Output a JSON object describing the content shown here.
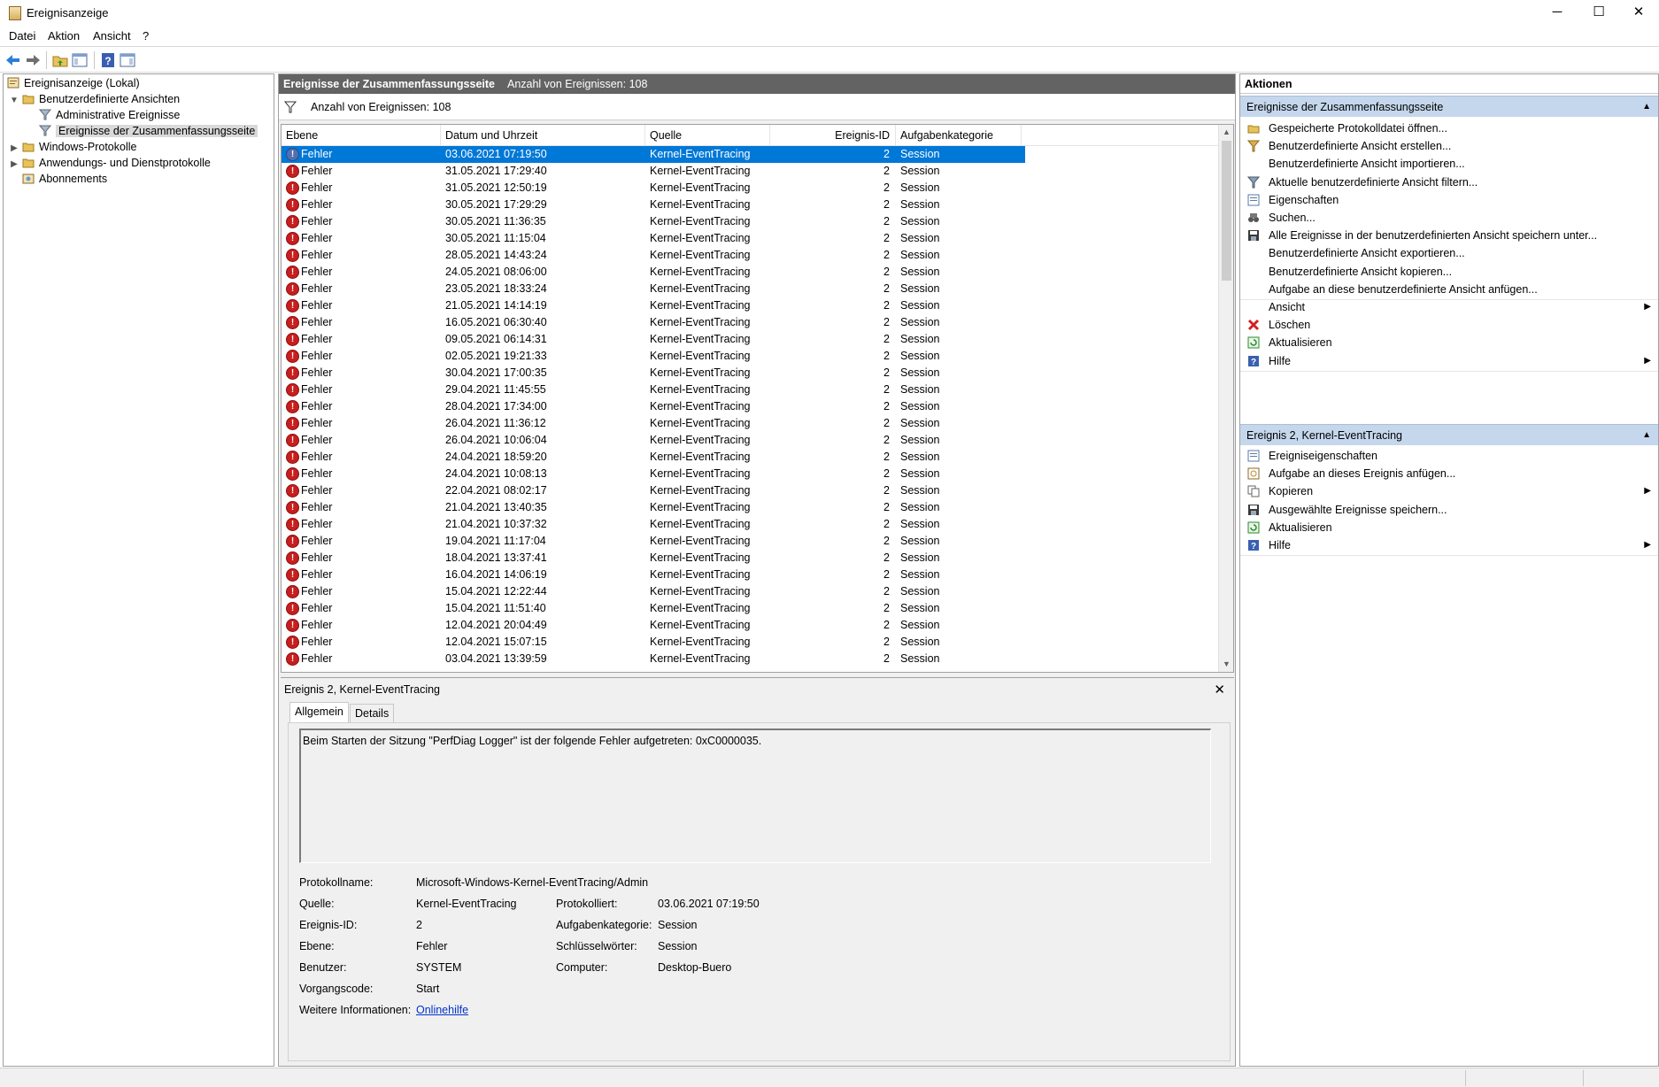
{
  "window": {
    "title": "Ereignisanzeige",
    "minimize_glyph": "─",
    "maximize_glyph": "☐",
    "close_glyph": "✕"
  },
  "menu": [
    "Datei",
    "Aktion",
    "Ansicht",
    "?"
  ],
  "toolbar_icons": [
    "back-icon",
    "forward-icon",
    "folder-up-icon",
    "show-hide-tree-icon",
    "help-icon",
    "action-pane-icon"
  ],
  "tree": {
    "root": "Ereignisanzeige (Lokal)",
    "custom_views": "Benutzerdefinierte Ansichten",
    "admin_events": "Administrative Ereignisse",
    "summary_events": "Ereignisse der Zusammenfassungsseite",
    "windows_logs": "Windows-Protokolle",
    "app_service_logs": "Anwendungs- und Dienstprotokolle",
    "subscriptions": "Abonnements"
  },
  "center": {
    "header_title": "Ereignisse der Zusammenfassungsseite",
    "header_count": "Anzahl von Ereignissen: 108",
    "filter_text": "Anzahl von Ereignissen: 108",
    "columns": [
      "Ebene",
      "Datum und Uhrzeit",
      "Quelle",
      "Ereignis-ID",
      "Aufgabenkategorie"
    ],
    "rows": [
      [
        "Fehler",
        "03.06.2021 07:19:50",
        "Kernel-EventTracing",
        "2",
        "Session"
      ],
      [
        "Fehler",
        "31.05.2021 17:29:40",
        "Kernel-EventTracing",
        "2",
        "Session"
      ],
      [
        "Fehler",
        "31.05.2021 12:50:19",
        "Kernel-EventTracing",
        "2",
        "Session"
      ],
      [
        "Fehler",
        "30.05.2021 17:29:29",
        "Kernel-EventTracing",
        "2",
        "Session"
      ],
      [
        "Fehler",
        "30.05.2021 11:36:35",
        "Kernel-EventTracing",
        "2",
        "Session"
      ],
      [
        "Fehler",
        "30.05.2021 11:15:04",
        "Kernel-EventTracing",
        "2",
        "Session"
      ],
      [
        "Fehler",
        "28.05.2021 14:43:24",
        "Kernel-EventTracing",
        "2",
        "Session"
      ],
      [
        "Fehler",
        "24.05.2021 08:06:00",
        "Kernel-EventTracing",
        "2",
        "Session"
      ],
      [
        "Fehler",
        "23.05.2021 18:33:24",
        "Kernel-EventTracing",
        "2",
        "Session"
      ],
      [
        "Fehler",
        "21.05.2021 14:14:19",
        "Kernel-EventTracing",
        "2",
        "Session"
      ],
      [
        "Fehler",
        "16.05.2021 06:30:40",
        "Kernel-EventTracing",
        "2",
        "Session"
      ],
      [
        "Fehler",
        "09.05.2021 06:14:31",
        "Kernel-EventTracing",
        "2",
        "Session"
      ],
      [
        "Fehler",
        "02.05.2021 19:21:33",
        "Kernel-EventTracing",
        "2",
        "Session"
      ],
      [
        "Fehler",
        "30.04.2021 17:00:35",
        "Kernel-EventTracing",
        "2",
        "Session"
      ],
      [
        "Fehler",
        "29.04.2021 11:45:55",
        "Kernel-EventTracing",
        "2",
        "Session"
      ],
      [
        "Fehler",
        "28.04.2021 17:34:00",
        "Kernel-EventTracing",
        "2",
        "Session"
      ],
      [
        "Fehler",
        "26.04.2021 11:36:12",
        "Kernel-EventTracing",
        "2",
        "Session"
      ],
      [
        "Fehler",
        "26.04.2021 10:06:04",
        "Kernel-EventTracing",
        "2",
        "Session"
      ],
      [
        "Fehler",
        "24.04.2021 18:59:20",
        "Kernel-EventTracing",
        "2",
        "Session"
      ],
      [
        "Fehler",
        "24.04.2021 10:08:13",
        "Kernel-EventTracing",
        "2",
        "Session"
      ],
      [
        "Fehler",
        "22.04.2021 08:02:17",
        "Kernel-EventTracing",
        "2",
        "Session"
      ],
      [
        "Fehler",
        "21.04.2021 13:40:35",
        "Kernel-EventTracing",
        "2",
        "Session"
      ],
      [
        "Fehler",
        "21.04.2021 10:37:32",
        "Kernel-EventTracing",
        "2",
        "Session"
      ],
      [
        "Fehler",
        "19.04.2021 11:17:04",
        "Kernel-EventTracing",
        "2",
        "Session"
      ],
      [
        "Fehler",
        "18.04.2021 13:37:41",
        "Kernel-EventTracing",
        "2",
        "Session"
      ],
      [
        "Fehler",
        "16.04.2021 14:06:19",
        "Kernel-EventTracing",
        "2",
        "Session"
      ],
      [
        "Fehler",
        "15.04.2021 12:22:44",
        "Kernel-EventTracing",
        "2",
        "Session"
      ],
      [
        "Fehler",
        "15.04.2021 11:51:40",
        "Kernel-EventTracing",
        "2",
        "Session"
      ],
      [
        "Fehler",
        "12.04.2021 20:04:49",
        "Kernel-EventTracing",
        "2",
        "Session"
      ],
      [
        "Fehler",
        "12.04.2021 15:07:15",
        "Kernel-EventTracing",
        "2",
        "Session"
      ],
      [
        "Fehler",
        "03.04.2021 13:39:59",
        "Kernel-EventTracing",
        "2",
        "Session"
      ]
    ],
    "selected_row": 0
  },
  "detail": {
    "title": "Ereignis 2, Kernel-EventTracing",
    "close_glyph": "✕",
    "tabs": [
      "Allgemein",
      "Details"
    ],
    "message": "Beim Starten der Sitzung \"PerfDiag Logger\" ist der folgende Fehler aufgetreten: 0xC0000035.",
    "labels": {
      "log_name": "Protokollname:",
      "source": "Quelle:",
      "event_id": "Ereignis-ID:",
      "level": "Ebene:",
      "user": "Benutzer:",
      "opcode": "Vorgangscode:",
      "more_info": "Weitere Informationen:",
      "logged": "Protokolliert:",
      "task_category": "Aufgabenkategorie:",
      "keywords": "Schlüsselwörter:",
      "computer": "Computer:"
    },
    "values": {
      "log_name": "Microsoft-Windows-Kernel-EventTracing/Admin",
      "source": "Kernel-EventTracing",
      "event_id": "2",
      "level": "Fehler",
      "user": "SYSTEM",
      "opcode": "Start",
      "more_info": "Onlinehilfe",
      "logged": "03.06.2021 07:19:50",
      "task_category": "Session",
      "keywords": "Session",
      "computer": "Desktop-Buero"
    }
  },
  "actions": {
    "header": "Aktionen",
    "section1": "Ereignisse der Zusammenfassungsseite",
    "section1_items": [
      "Gespeicherte Protokolldatei öffnen...",
      "Benutzerdefinierte Ansicht erstellen...",
      "Benutzerdefinierte Ansicht importieren...",
      "Aktuelle benutzerdefinierte Ansicht filtern...",
      "Eigenschaften",
      "Suchen...",
      "Alle Ereignisse in der benutzerdefinierten Ansicht speichern unter...",
      "Benutzerdefinierte Ansicht exportieren...",
      "Benutzerdefinierte Ansicht kopieren...",
      "Aufgabe an diese benutzerdefinierte Ansicht anfügen...",
      "Ansicht",
      "Löschen",
      "Aktualisieren",
      "Hilfe"
    ],
    "section2": "Ereignis 2, Kernel-EventTracing",
    "section2_items": [
      "Ereigniseigenschaften",
      "Aufgabe an dieses Ereignis anfügen...",
      "Kopieren",
      "Ausgewählte Ereignisse speichern...",
      "Aktualisieren",
      "Hilfe"
    ]
  }
}
